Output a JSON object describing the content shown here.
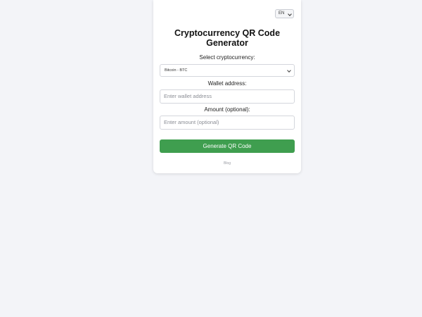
{
  "language": {
    "selected": "EN"
  },
  "title": "Cryptocurrency QR Code Generator",
  "crypto_select": {
    "label": "Select cryptocurrency:",
    "selected": "Bitcoin - BTC"
  },
  "wallet": {
    "label": "Wallet address:",
    "placeholder": "Enter wallet address"
  },
  "amount": {
    "label": "Amount (optional):",
    "placeholder": "Enter amount (optional)"
  },
  "generate_button": "Generate QR Code",
  "footer": "Blog"
}
